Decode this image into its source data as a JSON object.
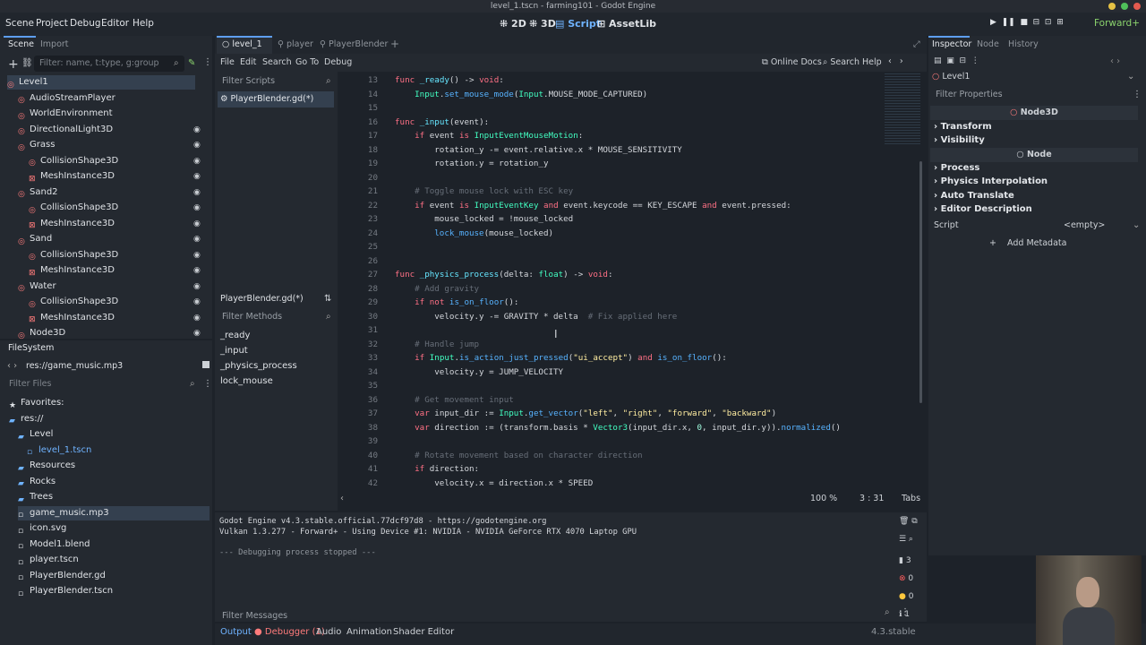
{
  "window_title": "level_1.tscn - farming101 - Godot Engine",
  "menu": [
    "Scene",
    "Project",
    "Debug",
    "Editor",
    "Help"
  ],
  "workspaces": [
    "2D",
    "3D",
    "Script",
    "AssetLib"
  ],
  "renderer": "Forward+",
  "scene_dock": {
    "tabs": [
      "Scene",
      "Import"
    ],
    "filter_placeholder": "Filter: name, t:type, g:group",
    "nodes": [
      {
        "label": "Level1",
        "indent": 0
      },
      {
        "label": "AudioStreamPlayer",
        "indent": 1
      },
      {
        "label": "WorldEnvironment",
        "indent": 1
      },
      {
        "label": "DirectionalLight3D",
        "indent": 1
      },
      {
        "label": "Grass",
        "indent": 1
      },
      {
        "label": "CollisionShape3D",
        "indent": 2
      },
      {
        "label": "MeshInstance3D",
        "indent": 2
      },
      {
        "label": "Sand2",
        "indent": 1
      },
      {
        "label": "CollisionShape3D",
        "indent": 2
      },
      {
        "label": "MeshInstance3D",
        "indent": 2
      },
      {
        "label": "Sand",
        "indent": 1
      },
      {
        "label": "CollisionShape3D",
        "indent": 2
      },
      {
        "label": "MeshInstance3D",
        "indent": 2
      },
      {
        "label": "Water",
        "indent": 1
      },
      {
        "label": "CollisionShape3D",
        "indent": 2
      },
      {
        "label": "MeshInstance3D",
        "indent": 2
      },
      {
        "label": "Node3D",
        "indent": 1
      }
    ]
  },
  "filesystem": {
    "title": "FileSystem",
    "path": "res://game_music.mp3",
    "filter_placeholder": "Filter Files",
    "items": [
      {
        "label": "Favorites:",
        "indent": 0
      },
      {
        "label": "res://",
        "indent": 0
      },
      {
        "label": "Level",
        "indent": 1
      },
      {
        "label": "level_1.tscn",
        "indent": 2
      },
      {
        "label": "Resources",
        "indent": 1
      },
      {
        "label": "Rocks",
        "indent": 1
      },
      {
        "label": "Trees",
        "indent": 1
      },
      {
        "label": "game_music.mp3",
        "indent": 1
      },
      {
        "label": "icon.svg",
        "indent": 1
      },
      {
        "label": "Model1.blend",
        "indent": 1
      },
      {
        "label": "player.tscn",
        "indent": 1
      },
      {
        "label": "PlayerBlender.gd",
        "indent": 1
      },
      {
        "label": "PlayerBlender.tscn",
        "indent": 1
      }
    ]
  },
  "editor_tabs": [
    "level_1",
    "player",
    "PlayerBlender"
  ],
  "script_menu": [
    "File",
    "Edit",
    "Search",
    "Go To",
    "Debug"
  ],
  "online_docs": "Online Docs",
  "search_help": "Search Help",
  "filter_scripts": "Filter Scripts",
  "open_script": "PlayerBlender.gd(*)",
  "script_label": "PlayerBlender.gd(*)",
  "filter_methods": "Filter Methods",
  "methods": [
    "_ready",
    "_input",
    "_physics_process",
    "lock_mouse"
  ],
  "code_lines": [
    {
      "n": "13",
      "h": "<span class='kw'>func</span> <span class='fn'>_ready</span>() -> <span class='kw'>void</span>:"
    },
    {
      "n": "14",
      "h": "    <span class='ty'>Input</span>.<span class='me'>set_mouse_mode</span>(<span class='ty'>Input</span>.MOUSE_MODE_CAPTURED)"
    },
    {
      "n": "15",
      "h": ""
    },
    {
      "n": "16",
      "h": "<span class='kw'>func</span> <span class='fn'>_input</span>(event):"
    },
    {
      "n": "17",
      "h": "    <span class='kw'>if</span> event <span class='kw'>is</span> <span class='ty'>InputEventMouseMotion</span>:"
    },
    {
      "n": "18",
      "h": "        rotation_y -= event.relative.x * MOUSE_SENSITIVITY"
    },
    {
      "n": "19",
      "h": "        rotation.y = rotation_y"
    },
    {
      "n": "20",
      "h": ""
    },
    {
      "n": "21",
      "h": "    <span class='cm'># Toggle mouse lock with ESC key</span>"
    },
    {
      "n": "22",
      "h": "    <span class='kw'>if</span> event <span class='kw'>is</span> <span class='ty'>InputEventKey</span> <span class='kw'>and</span> event.keycode == KEY_ESCAPE <span class='kw'>and</span> event.pressed:"
    },
    {
      "n": "23",
      "h": "        mouse_locked = !mouse_locked"
    },
    {
      "n": "24",
      "h": "        <span class='me'>lock_mouse</span>(mouse_locked)"
    },
    {
      "n": "25",
      "h": ""
    },
    {
      "n": "26",
      "h": ""
    },
    {
      "n": "27",
      "h": "<span class='kw'>func</span> <span class='fn'>_physics_process</span>(delta: <span class='ty'>float</span>) -> <span class='kw'>void</span>:"
    },
    {
      "n": "28",
      "h": "    <span class='cm'># Add gravity</span>"
    },
    {
      "n": "29",
      "h": "    <span class='kw'>if</span> <span class='kw'>not</span> <span class='me'>is_on_floor</span>():"
    },
    {
      "n": "30",
      "h": "        velocity.y -= GRAVITY * delta  <span class='cm'># Fix applied here</span>"
    },
    {
      "n": "31",
      "h": ""
    },
    {
      "n": "32",
      "h": "    <span class='cm'># Handle jump</span>"
    },
    {
      "n": "33",
      "h": "    <span class='kw'>if</span> <span class='ty'>Input</span>.<span class='me'>is_action_just_pressed</span>(<span class='st'>\"ui_accept\"</span>) <span class='kw'>and</span> <span class='me'>is_on_floor</span>():"
    },
    {
      "n": "34",
      "h": "        velocity.y = JUMP_VELOCITY"
    },
    {
      "n": "35",
      "h": ""
    },
    {
      "n": "36",
      "h": "    <span class='cm'># Get movement input</span>"
    },
    {
      "n": "37",
      "h": "    <span class='kw'>var</span> input_dir := <span class='ty'>Input</span>.<span class='me'>get_vector</span>(<span class='st'>\"left\"</span>, <span class='st'>\"right\"</span>, <span class='st'>\"forward\"</span>, <span class='st'>\"backward\"</span>)"
    },
    {
      "n": "38",
      "h": "    <span class='kw'>var</span> direction := (transform.basis * <span class='ty'>Vector3</span>(input_dir.x, <span class='num'>0</span>, input_dir.y)).<span class='me'>normalized</span>()"
    },
    {
      "n": "39",
      "h": ""
    },
    {
      "n": "40",
      "h": "    <span class='cm'># Rotate movement based on character direction</span>"
    },
    {
      "n": "41",
      "h": "    <span class='kw'>if</span> direction:"
    },
    {
      "n": "42",
      "h": "        velocity.x = direction.x * SPEED"
    }
  ],
  "zoom": "100 %",
  "cursor_pos": "3 :  31",
  "indent_mode": "Tabs",
  "output_lines": [
    "Godot Engine v4.3.stable.official.77dcf97d8 - https://godotengine.org",
    "Vulkan 1.3.277 - Forward+ - Using Device #1: NVIDIA - NVIDIA GeForce RTX 4070 Laptop GPU",
    "",
    "--- Debugging process stopped ---"
  ],
  "filter_messages": "Filter Messages",
  "counts": [
    "3",
    "0",
    "0",
    "1"
  ],
  "bottom_tabs": [
    "Output",
    "Debugger (1)",
    "Audio",
    "Animation",
    "Shader Editor"
  ],
  "version": "4.3.stable",
  "inspector": {
    "tabs": [
      "Inspector",
      "Node",
      "History"
    ],
    "object": "Level1",
    "filter": "Filter Properties",
    "class1": "Node3D",
    "class2": "Node",
    "sections": [
      "Transform",
      "Visibility",
      "Process",
      "Physics Interpolation",
      "Auto Translate",
      "Editor Description"
    ],
    "script_label": "Script",
    "script_value": "<empty>",
    "add_metadata": "Add Metadata"
  }
}
